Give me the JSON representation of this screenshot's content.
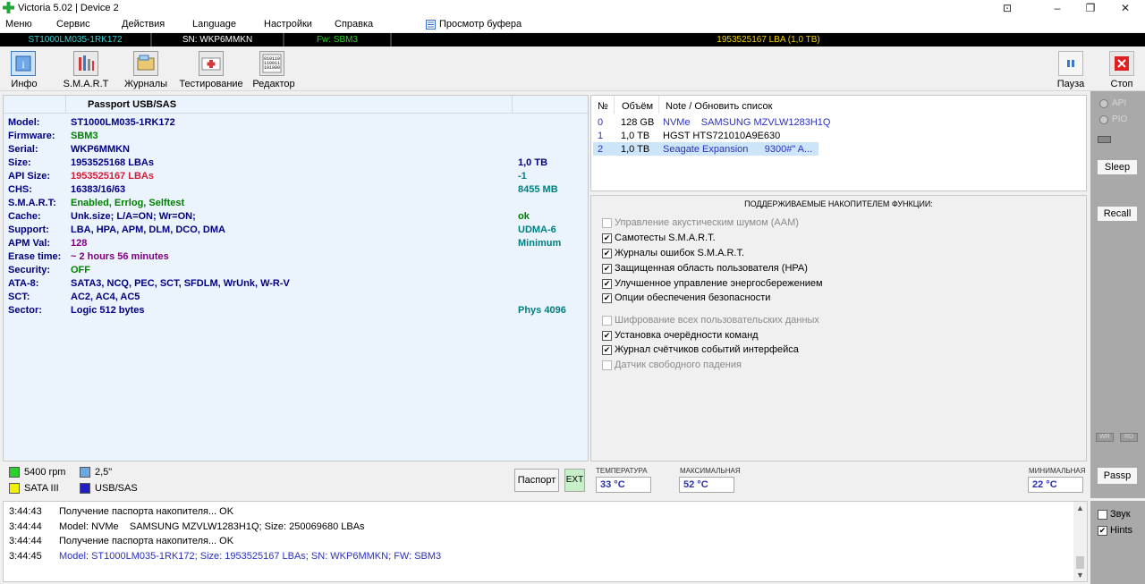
{
  "titlebar": {
    "title": "Victoria 5.02 | Device 2",
    "minimize": "–",
    "maximize": "❐",
    "close": "✕",
    "pin": "⊡"
  },
  "menu": {
    "items": [
      "Меню",
      "Сервис",
      "Действия",
      "Language",
      "Настройки",
      "Справка"
    ],
    "buffer_view": "Просмотр буфера"
  },
  "infobar": {
    "model": "ST1000LM035-1RK172",
    "sn": "SN: WKP6MMKN",
    "fw": "Fw: SBM3",
    "lba": "1953525167 LBA (1,0 TB)"
  },
  "toolbar": {
    "info": "Инфо",
    "smart": "S.M.A.R.T",
    "logs": "Журналы",
    "test": "Тестирование",
    "editor": "Редактор",
    "pause": "Пауза",
    "stop": "Стоп"
  },
  "passport": {
    "header": "Passport USB/SAS",
    "rows": [
      {
        "k": "Model:",
        "v": "ST1000LM035-1RK172",
        "r": "",
        "vc": "#000080",
        "rc": "#008080"
      },
      {
        "k": "Firmware:",
        "v": "SBM3",
        "r": "",
        "vc": "#008000",
        "rc": "#008080"
      },
      {
        "k": "Serial:",
        "v": "WKP6MMKN",
        "r": "",
        "vc": "#000080",
        "rc": "#008080"
      },
      {
        "k": "Size:",
        "v": "1953525168 LBAs",
        "r": "1,0 TB",
        "vc": "#000080",
        "rc": "#000080"
      },
      {
        "k": "API Size:",
        "v": "1953525167 LBAs",
        "r": "-1",
        "vc": "#d0203a",
        "rc": "#008080"
      },
      {
        "k": "CHS:",
        "v": "16383/16/63",
        "r": "8455 MB",
        "vc": "#000080",
        "rc": "#008080"
      },
      {
        "k": "S.M.A.R.T:",
        "v": "Enabled, Errlog, Selftest",
        "r": "",
        "vc": "#008000",
        "rc": "#008080"
      },
      {
        "k": "Cache:",
        "v": "Unk.size; L/A=ON; Wr=ON;",
        "r": "ok",
        "vc": "#000080",
        "rc": "#008000"
      },
      {
        "k": "Support:",
        "v": "LBA, HPA, APM, DLM, DCO, DMA",
        "r": "UDMA-6",
        "vc": "#000080",
        "rc": "#008080"
      },
      {
        "k": "APM Val:",
        "v": "128",
        "r": "Minimum",
        "vc": "#800080",
        "rc": "#008080"
      },
      {
        "k": "Erase time:",
        "v": "~ 2 hours 56 minutes",
        "r": "",
        "vc": "#800080",
        "rc": "#008080"
      },
      {
        "k": "Security:",
        "v": "OFF",
        "r": "",
        "vc": "#008000",
        "rc": "#008080"
      },
      {
        "k": "ATA-8:",
        "v": "SATA3, NCQ, PEC, SCT, SFDLM, WrUnk, W-R-V",
        "r": "",
        "vc": "#000080",
        "rc": "#008080"
      },
      {
        "k": "SCT:",
        "v": "AC2, AC4, AC5",
        "r": "",
        "vc": "#000080",
        "rc": "#008080"
      },
      {
        "k": "Sector:",
        "v": "Logic 512 bytes",
        "r": "Phys 4096",
        "vc": "#000080",
        "rc": "#008080"
      }
    ]
  },
  "legend": {
    "rpm": "5400 rpm",
    "form": "2,5\"",
    "iface": "SATA III",
    "bus": "USB/SAS",
    "rpm_color": "#2bd12b",
    "form_color": "#6ea8e0",
    "iface_color": "#f0f000",
    "bus_color": "#2020c0",
    "passport_btn": "Паспорт",
    "ext_btn": "EXT"
  },
  "drives": {
    "headers": [
      "№",
      "Объём",
      "Note / Обновить список"
    ],
    "rows": [
      {
        "n": "0",
        "size": "128 GB",
        "note": "NVMe    SAMSUNG MZVLW1283H1Q"
      },
      {
        "n": "1",
        "size": "1,0 TB",
        "note": "HGST HTS721010A9E630"
      },
      {
        "n": "2",
        "size": "1,0 TB",
        "note": "Seagate Expansion      9300#\" A..."
      }
    ]
  },
  "features": {
    "title": "ПОДДЕРЖИВАЕМЫЕ НАКОПИТЕЛЕМ ФУНКЦИИ:",
    "items": [
      {
        "label": "Управление акустическим шумом (AAM)",
        "checked": false,
        "enabled": false
      },
      {
        "label": "Самотесты S.M.A.R.T.",
        "checked": true,
        "enabled": true
      },
      {
        "label": "Журналы ошибок S.M.A.R.T.",
        "checked": true,
        "enabled": true
      },
      {
        "label": "Защищенная область пользователя (HPA)",
        "checked": true,
        "enabled": true
      },
      {
        "label": "Улучшенное управление энергосбережением",
        "checked": true,
        "enabled": true
      },
      {
        "label": "Опции обеспечения безопасности",
        "checked": true,
        "enabled": true
      },
      {
        "label": "Шифрование всех пользовательских данных",
        "checked": false,
        "enabled": false
      },
      {
        "label": "Установка очерёдности команд",
        "checked": true,
        "enabled": true
      },
      {
        "label": "Журнал счётчиков событий интерфейса",
        "checked": true,
        "enabled": true
      },
      {
        "label": "Датчик свободного падения",
        "checked": false,
        "enabled": false
      }
    ]
  },
  "temps": {
    "cur_label": "ТЕМПЕРАТУРА",
    "cur": "33 °C",
    "max_label": "МАКСИМАЛЬНАЯ",
    "max": "52 °C",
    "min_label": "МИНИМАЛЬНАЯ",
    "min": "22 °C"
  },
  "side": {
    "api": "API",
    "pio": "PIO",
    "sleep": "Sleep",
    "recall": "Recall",
    "wr": "WR",
    "rd": "RD",
    "passp": "Passp"
  },
  "log": {
    "lines": [
      {
        "t": "3:44:43",
        "m": "Получение паспорта накопителя... OK",
        "c": "#000000"
      },
      {
        "t": "3:44:44",
        "m": "Model: NVMe    SAMSUNG MZVLW1283H1Q; Size: 250069680 LBAs",
        "c": "#000000"
      },
      {
        "t": "3:44:44",
        "m": "Получение паспорта накопителя... OK",
        "c": "#000000"
      },
      {
        "t": "3:44:45",
        "m": "Model: ST1000LM035-1RK172; Size: 1953525167 LBAs; SN: WKP6MMKN; FW: SBM3",
        "c": "#2a30c0"
      }
    ]
  },
  "options": {
    "sound": "Звук",
    "hints": "Hints",
    "sound_checked": false,
    "hints_checked": true
  }
}
